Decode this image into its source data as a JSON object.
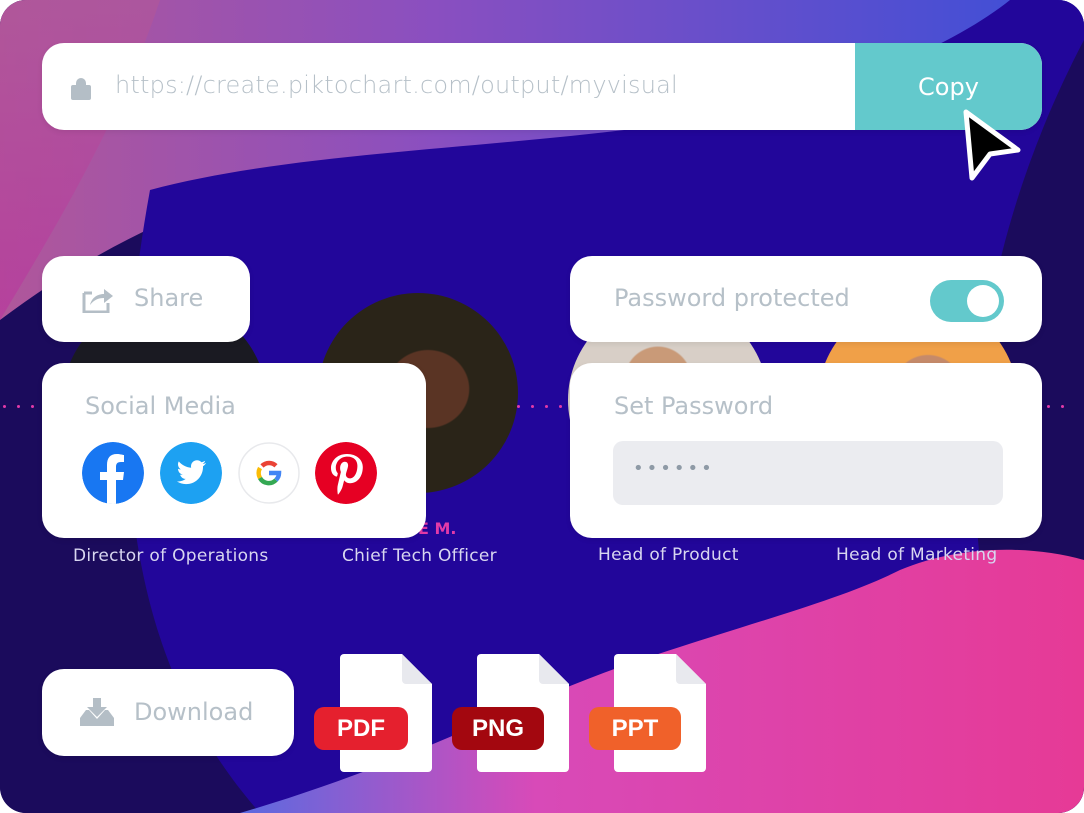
{
  "url_bar": {
    "lock_icon": "lock-icon",
    "url": "https://create.piktochart.com/output/myvisual",
    "copy_label": "Copy"
  },
  "share": {
    "icon": "share-icon",
    "label": "Share"
  },
  "password_protected": {
    "label": "Password protected",
    "toggle_on": true
  },
  "social_media": {
    "title": "Social Media",
    "networks": [
      {
        "name": "Facebook",
        "icon": "facebook-icon",
        "color": "#1877f2"
      },
      {
        "name": "Twitter",
        "icon": "twitter-icon",
        "color": "#1da1f2"
      },
      {
        "name": "Google",
        "icon": "google-icon",
        "color": "#ffffff"
      },
      {
        "name": "Pinterest",
        "icon": "pinterest-icon",
        "color": "#e60023"
      }
    ]
  },
  "set_password": {
    "title": "Set Password",
    "value_masked": "••••••"
  },
  "team": {
    "name_fragment": "E M.",
    "roles": [
      "Director of Operations",
      "Chief Tech Officer",
      "Head of Product",
      "Head of Marketing"
    ]
  },
  "download": {
    "icon": "download-icon",
    "label": "Download",
    "formats": [
      {
        "label": "PDF",
        "color": "#e5202e"
      },
      {
        "label": "PNG",
        "color": "#a3070f"
      },
      {
        "label": "PPT",
        "color": "#f0612a"
      }
    ]
  },
  "colors": {
    "accent_teal": "#63c9cc",
    "muted_text": "#b6c0c8",
    "bg_indigo": "#22069a",
    "bg_pink": "#e63a9c"
  }
}
